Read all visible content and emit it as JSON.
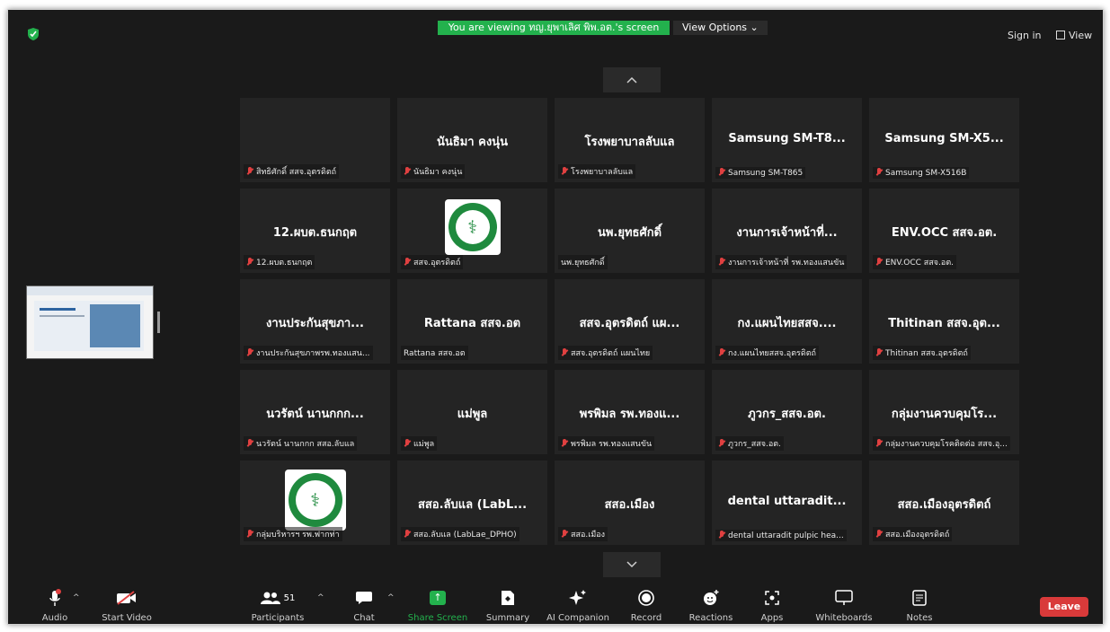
{
  "banner": {
    "text": "You are viewing ทญ.ยุพาเลิศ พิพ.อต.'s screen",
    "view_options": "View Options"
  },
  "top_right": {
    "sign_in": "Sign in",
    "view": "View"
  },
  "tiles": [
    {
      "title": "",
      "name": "สิทธิศักดิ์ สสจ.อุตรดิตถ์"
    },
    {
      "title": "นันธิมา คงนุ่น",
      "name": "นันธิมา คงนุ่น"
    },
    {
      "title": "โรงพยาบาลลับแล",
      "name": "โรงพยาบาลลับแล"
    },
    {
      "title": "Samsung SM-T8...",
      "name": "Samsung SM-T865"
    },
    {
      "title": "Samsung SM-X5...",
      "name": "Samsung SM-X516B"
    },
    {
      "title": "12.ผบต.ธนกฤต",
      "name": "12.ผบต.ธนกฤต"
    },
    {
      "title": "",
      "name": "สสจ.อุตรดิตถ์"
    },
    {
      "title": "นพ.ยุทธศักดิ์",
      "name": "นพ.ยุทธศักดิ์"
    },
    {
      "title": "งานการเจ้าหน้าที่...",
      "name": "งานการเจ้าหน้าที่ รพ.ทองแสนขัน"
    },
    {
      "title": "ENV.OCC สสจ.อต.",
      "name": "ENV.OCC สสจ.อต."
    },
    {
      "title": "งานประกันสุขภา...",
      "name": "งานประกันสุขภาพรพ.ทองแสน..."
    },
    {
      "title": "Rattana สสจ.อต",
      "name": "Rattana สสจ.อต"
    },
    {
      "title": "สสจ.อุตรดิตถ์ แผ...",
      "name": "สสจ.อุตรดิตถ์ แผนไทย"
    },
    {
      "title": "กง.แผนไทยสสจ....",
      "name": "กง.แผนไทยสสจ.อุตรดิตถ์"
    },
    {
      "title": "Thitinan สสจ.อุต...",
      "name": "Thitinan สสจ.อุตรดิตถ์"
    },
    {
      "title": "นวรัตน์ นานกกก...",
      "name": "นวรัตน์ นานกกก สสอ.ลับแล"
    },
    {
      "title": "แม่พูล",
      "name": "แม่พูล"
    },
    {
      "title": "พรพิมล รพ.ทองแ...",
      "name": "พรพิมล รพ.ทองแสนขัน"
    },
    {
      "title": "ภูวกร_สสจ.อต.",
      "name": "ภูวกร_สสจ.อต."
    },
    {
      "title": "กลุ่มงานควบคุมโร...",
      "name": "กลุ่มงานควบคุมโรคติดต่อ สสจ.อุ..."
    },
    {
      "title": "",
      "name": "กลุ่มบริหารฯ รพ.ฟากท่า"
    },
    {
      "title": "สสอ.ลับแล (LabL...",
      "name": "สสอ.ลับแล (LabLae_DPHO)"
    },
    {
      "title": "สสอ.เมือง",
      "name": "สสอ.เมือง"
    },
    {
      "title": "dental uttaradit...",
      "name": "dental uttaradit pulpic hea..."
    },
    {
      "title": "สสอ.เมืองอุตรดิตถ์",
      "name": "สสอ.เมืองอุตรดิตถ์"
    }
  ],
  "toolbar": {
    "audio": "Audio",
    "start_video": "Start Video",
    "participants": "Participants",
    "participants_count": "51",
    "chat": "Chat",
    "share_screen": "Share Screen",
    "summary": "Summary",
    "ai_companion": "AI Companion",
    "record": "Record",
    "reactions": "Reactions",
    "apps": "Apps",
    "whiteboards": "Whiteboards",
    "notes": "Notes",
    "leave": "Leave"
  },
  "colors": {
    "share_green": "#23b14d",
    "leave_red": "#d93a3a",
    "muted_red": "#e04040",
    "tile_bg": "#242424"
  }
}
